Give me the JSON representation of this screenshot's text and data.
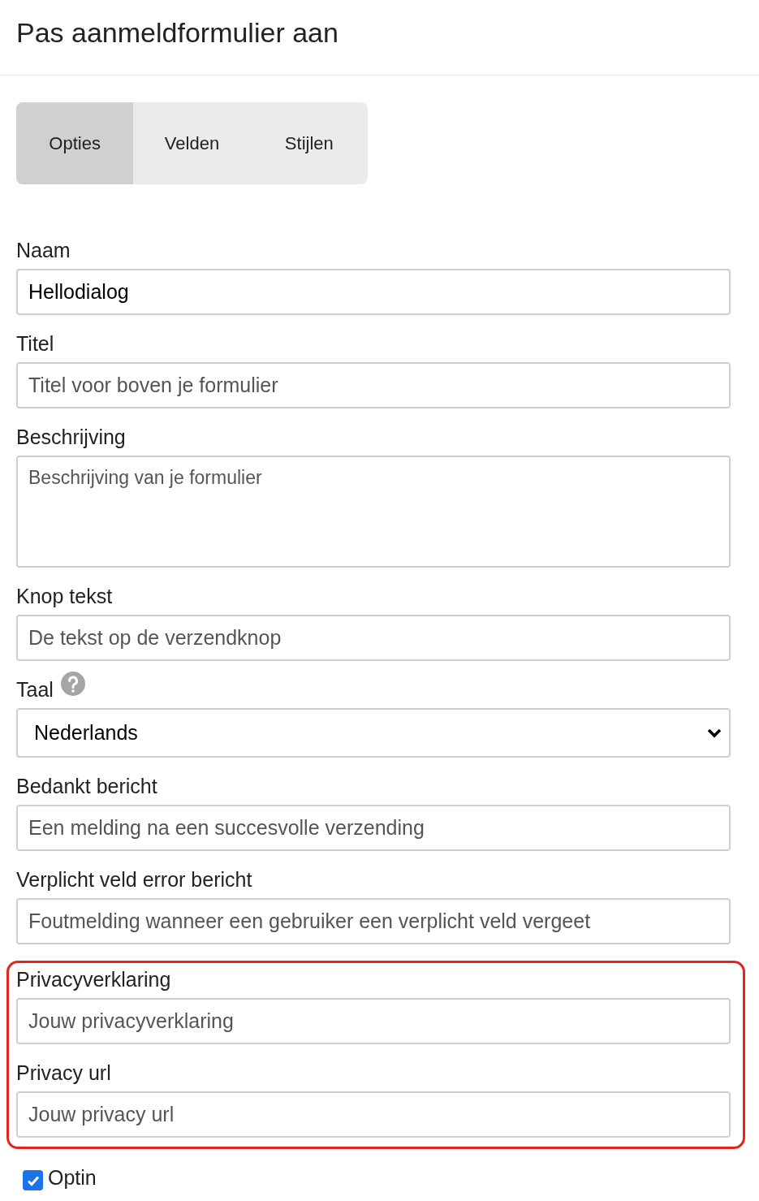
{
  "title": "Pas aanmeldformulier aan",
  "tabs": [
    {
      "label": "Opties",
      "selected": true
    },
    {
      "label": "Velden",
      "selected": false
    },
    {
      "label": "Stijlen",
      "selected": false
    }
  ],
  "sections": [
    {
      "highlighted": false,
      "fields": [
        {
          "kind": "input",
          "label": "Naam",
          "value": "Hellodialog"
        },
        {
          "kind": "input",
          "label": "Titel",
          "placeholder": "Titel voor boven je formulier"
        },
        {
          "kind": "textarea",
          "label": "Beschrijving",
          "placeholder": "Beschrijving van je formulier"
        },
        {
          "kind": "input",
          "label": "Knop tekst",
          "placeholder": "De tekst op de verzendknop"
        },
        {
          "kind": "select",
          "label": "Taal",
          "help": true,
          "value": "Nederlands"
        },
        {
          "kind": "input",
          "label": "Bedankt bericht",
          "placeholder": "Een melding na een succesvolle verzending"
        },
        {
          "kind": "input",
          "label": "Verplicht veld error bericht",
          "placeholder": "Foutmelding wanneer een gebruiker een verplicht veld vergeet"
        }
      ]
    },
    {
      "highlighted": true,
      "fields": [
        {
          "kind": "input",
          "label": "Privacyverklaring",
          "placeholder": "Jouw privacyverklaring"
        },
        {
          "kind": "input",
          "label": "Privacy url",
          "placeholder": "Jouw privacy url"
        }
      ]
    }
  ],
  "optin": {
    "label": "Optin",
    "checked": true
  }
}
